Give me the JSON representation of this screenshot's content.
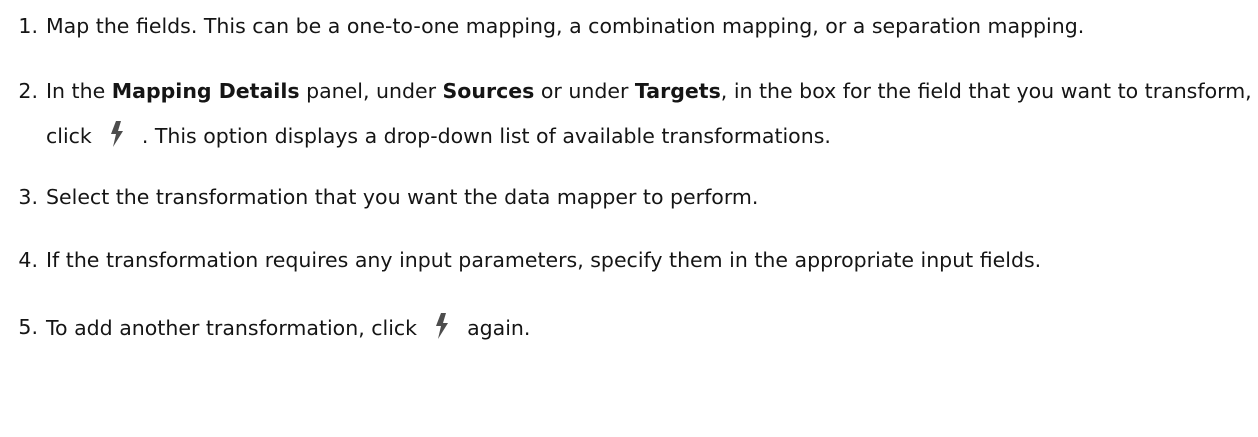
{
  "steps": [
    {
      "number": "1",
      "text": "Map the fields. This can be a one-to-one mapping, a combination mapping, or a separation mapping."
    },
    {
      "number": "2",
      "part1": "In the ",
      "bold1": "Mapping Details",
      "part2": " panel, under ",
      "bold2": "Sources",
      "part3": " or under ",
      "bold3": "Targets",
      "part4": ", in the box for the field that you want to transform, click",
      "icon": "lightning-bolt-icon",
      "part5": ". This option displays a drop-down list of available transformations."
    },
    {
      "number": "3",
      "text": "Select the transformation that you want the data mapper to perform."
    },
    {
      "number": "4",
      "text": "If the transformation requires any input parameters, specify them in the appropriate input fields."
    },
    {
      "number": "5",
      "part1": "To add another transformation, click",
      "icon": "lightning-bolt-icon",
      "part2": "again."
    }
  ],
  "colors": {
    "text": "#151515",
    "icon": "#4d4d4d"
  }
}
